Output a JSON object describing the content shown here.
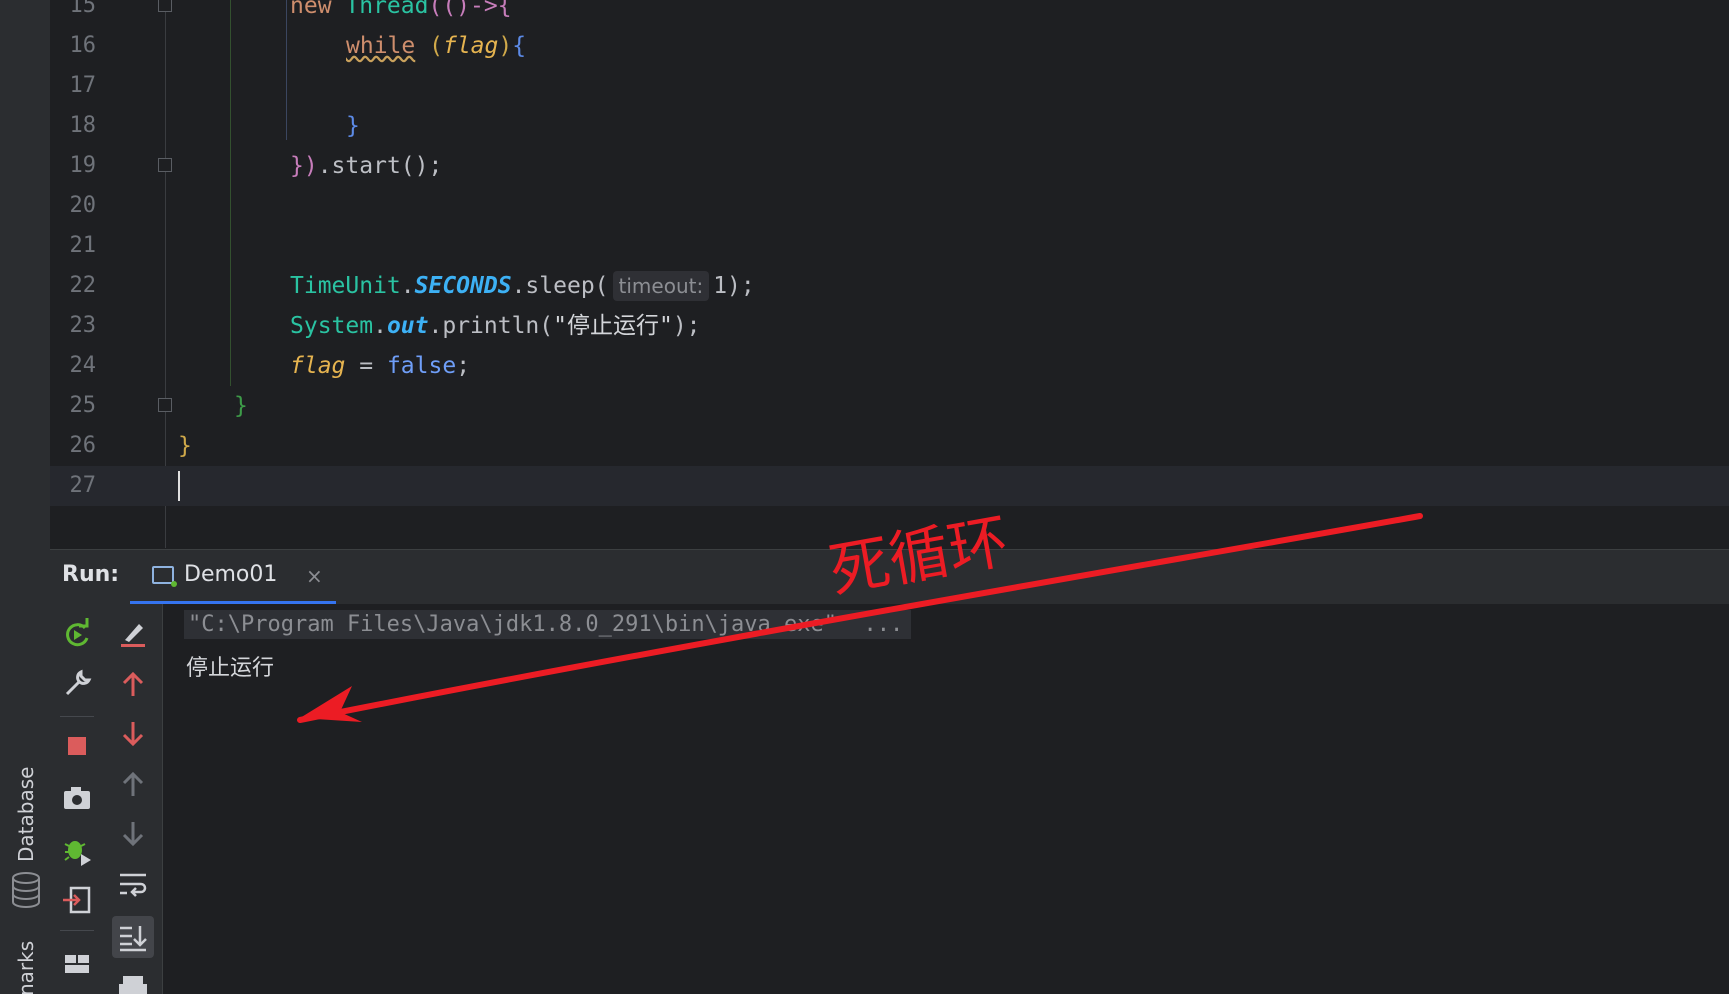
{
  "sidebar": {
    "database_label": "Database",
    "bookmarks_label": "narks"
  },
  "editor": {
    "lines": [
      {
        "num": "15"
      },
      {
        "num": "16"
      },
      {
        "num": "17"
      },
      {
        "num": "18"
      },
      {
        "num": "19"
      },
      {
        "num": "20"
      },
      {
        "num": "21"
      },
      {
        "num": "22"
      },
      {
        "num": "23"
      },
      {
        "num": "24"
      },
      {
        "num": "25"
      },
      {
        "num": "26"
      },
      {
        "num": "27"
      }
    ],
    "code": {
      "l15_new": "new",
      "l15_thread": " Thread",
      "l15_rest": "(()->{",
      "l16_while": "while",
      "l16_flag": "flag",
      "l18_brace": "}",
      "l19_close": "})",
      "l19_start": ".start();",
      "l22_timeunit": "TimeUnit",
      "l22_seconds": "SECONDS",
      "l22_sleep": ".sleep(",
      "l22_hint": "timeout:",
      "l22_arg": "1);",
      "l23_system": "System",
      "l23_out": "out",
      "l23_println": ".println(",
      "l23_str": "\"停止运行\"",
      "l23_end": ");",
      "l24_flag": "flag",
      "l24_eq": " = ",
      "l24_false": "false",
      "l24_semi": ";",
      "l25_brace": "}",
      "l26_brace": "}"
    }
  },
  "run": {
    "title": "Run:",
    "tab_label": "Demo01",
    "tab_close": "×",
    "command": "\"C:\\Program Files\\Java\\jdk1.8.0_291\\bin\\java.exe\"  ...",
    "output": "停止运行"
  },
  "annotation": {
    "text": "死循环",
    "color": "#ec1c24"
  }
}
